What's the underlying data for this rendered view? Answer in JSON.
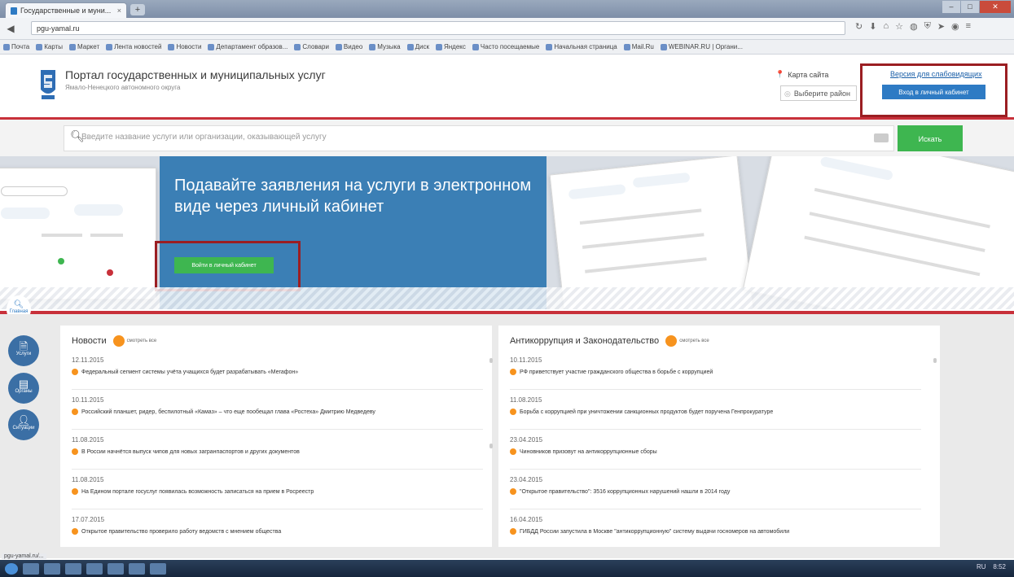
{
  "browser": {
    "tab_title": "Государственные и муни...",
    "url": "pgu-yamal.ru",
    "bookmarks": [
      "Почта",
      "Карты",
      "Маркет",
      "Лента новостей",
      "Новости",
      "Департамент образов...",
      "Словари",
      "Видео",
      "Музыка",
      "Диск",
      "Яндекс",
      "Часто посещаемые",
      "Начальная страница",
      "Mail.Ru",
      "WEBINAR.RU | Органи..."
    ],
    "status_url": "pgu-yamal.ru/..."
  },
  "header": {
    "title": "Портал государственных и муниципальных услуг",
    "subtitle": "Ямало-Ненецкого автономного округа",
    "sitemap": "Карта сайта",
    "region_select": "Выберите район",
    "vision_version": "Версия для слабовидящих",
    "login_button": "Вход в личный кабинет"
  },
  "search": {
    "placeholder": "Введите название услуги или организации, оказывающей услугу",
    "button": "Искать"
  },
  "hero": {
    "title": "Подавайте заявления на услуги в электронном виде через личный кабинет",
    "button": "Войти в личный кабинет"
  },
  "sidebar": {
    "main": "Главная",
    "items": [
      "Услуги",
      "Органы",
      "Ситуации"
    ]
  },
  "news": {
    "title": "Новости",
    "all_label": "смотреть все",
    "items": [
      {
        "date": "12.11.2015",
        "text": "Федеральный сегмент системы учёта учащихся будет разрабатывать «Мегафон»"
      },
      {
        "date": "10.11.2015",
        "text": "Российский планшет, ридер, беспилотный «Камаз» – что еще пообещал глава «Ростеха» Дмитрию Медведеву"
      },
      {
        "date": "11.08.2015",
        "text": "В России начнётся выпуск чипов для новых загранпаспортов и других документов"
      },
      {
        "date": "11.08.2015",
        "text": "На Едином портале госуслуг появилась возможность записаться на прием в Росреестр"
      },
      {
        "date": "17.07.2015",
        "text": "Открытое правительство проверило работу ведомств с мнением общества"
      }
    ]
  },
  "anticorr": {
    "title": "Антикоррупция и Законодательство",
    "all_label": "смотреть все",
    "items": [
      {
        "date": "10.11.2015",
        "text": "РФ приветствует участие гражданского общества в борьбе с коррупцией"
      },
      {
        "date": "11.08.2015",
        "text": "Борьба с коррупцией при уничтожении санкционных продуктов будет поручена Генпрокуратуре"
      },
      {
        "date": "23.04.2015",
        "text": "Чиновников призовут на антикоррупционные сборы"
      },
      {
        "date": "23.04.2015",
        "text": "\"Открытое правительство\": 3516 коррупционных нарушений нашли в 2014 году"
      },
      {
        "date": "16.04.2015",
        "text": "ГИБДД России запустила в Москве \"антикоррупционную\" систему выдачи госномеров на автомобили"
      }
    ]
  },
  "taskbar": {
    "tray_text": "RU",
    "clock": "8:52"
  },
  "colors": {
    "accent_red": "#c8303a",
    "highlight": "#9b1e22",
    "green": "#3eb650",
    "blue": "#2e7bc4",
    "orange": "#f7931e"
  }
}
